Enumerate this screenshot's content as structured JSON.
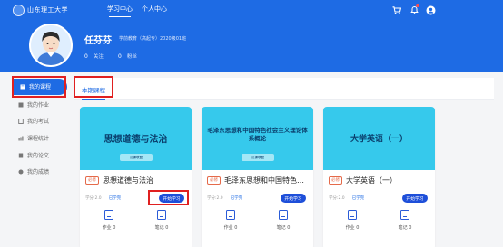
{
  "header": {
    "logo_text": "山东理工大学",
    "nav_tabs": [
      {
        "label": "学习中心",
        "active": true
      },
      {
        "label": "个人中心",
        "active": false
      }
    ],
    "icons": [
      "cart-icon",
      "bell-icon",
      "user-circle-icon"
    ]
  },
  "profile": {
    "name": "任芬芬",
    "info": "学前教育（高起专）2020级01班",
    "stats": [
      {
        "number": "0",
        "label": "关注"
      },
      {
        "number": "0",
        "label": "粉丝"
      }
    ]
  },
  "sidebar": {
    "items": [
      {
        "label": "我的课程",
        "icon": "book-icon",
        "active": true
      },
      {
        "label": "我的作业",
        "icon": "homework-icon",
        "active": false
      },
      {
        "label": "我的考试",
        "icon": "exam-icon",
        "active": false
      },
      {
        "label": "课程统计",
        "icon": "stats-icon",
        "active": false
      },
      {
        "label": "我的论文",
        "icon": "paper-icon",
        "active": false
      },
      {
        "label": "我的成绩",
        "icon": "grade-icon",
        "active": false
      }
    ]
  },
  "tabs": {
    "term_label": "本期课程"
  },
  "courses": [
    {
      "cover_title": "思想道德与法治",
      "badge_text": "优课联盟",
      "required_label": "必修",
      "name": "思想道德与法治",
      "credits_label": "学分:2.0",
      "status_label": "已学完",
      "start_label": "开始学习",
      "actions": [
        {
          "label": "作业 0",
          "icon": "homework-doc-icon"
        },
        {
          "label": "笔记 0",
          "icon": "note-doc-icon"
        }
      ]
    },
    {
      "cover_title": "毛泽东思想和中国特色社会主义理论体系概论",
      "badge_text": "优课联盟",
      "required_label": "必修",
      "name": "毛泽东思想和中国特色社会主义理论体系概论",
      "credits_label": "学分:2.0",
      "status_label": "已学完",
      "start_label": "开始学习",
      "actions": [
        {
          "label": "作业 0",
          "icon": "homework-doc-icon"
        },
        {
          "label": "笔记 0",
          "icon": "note-doc-icon"
        }
      ]
    },
    {
      "cover_title": "大学英语（一）",
      "badge_text": "",
      "required_label": "必修",
      "name": "大学英语（一）",
      "credits_label": "学分:2.0",
      "status_label": "已学完",
      "start_label": "开始学习",
      "actions": [
        {
          "label": "作业 0",
          "icon": "homework-doc-icon"
        },
        {
          "label": "笔记 0",
          "icon": "note-doc-icon"
        }
      ]
    }
  ],
  "colors": {
    "brand": "#1e6be4",
    "cover": "#36c9ec",
    "highlight": "#e02020",
    "button": "#1e4fd9",
    "required": "#e56a4a"
  }
}
